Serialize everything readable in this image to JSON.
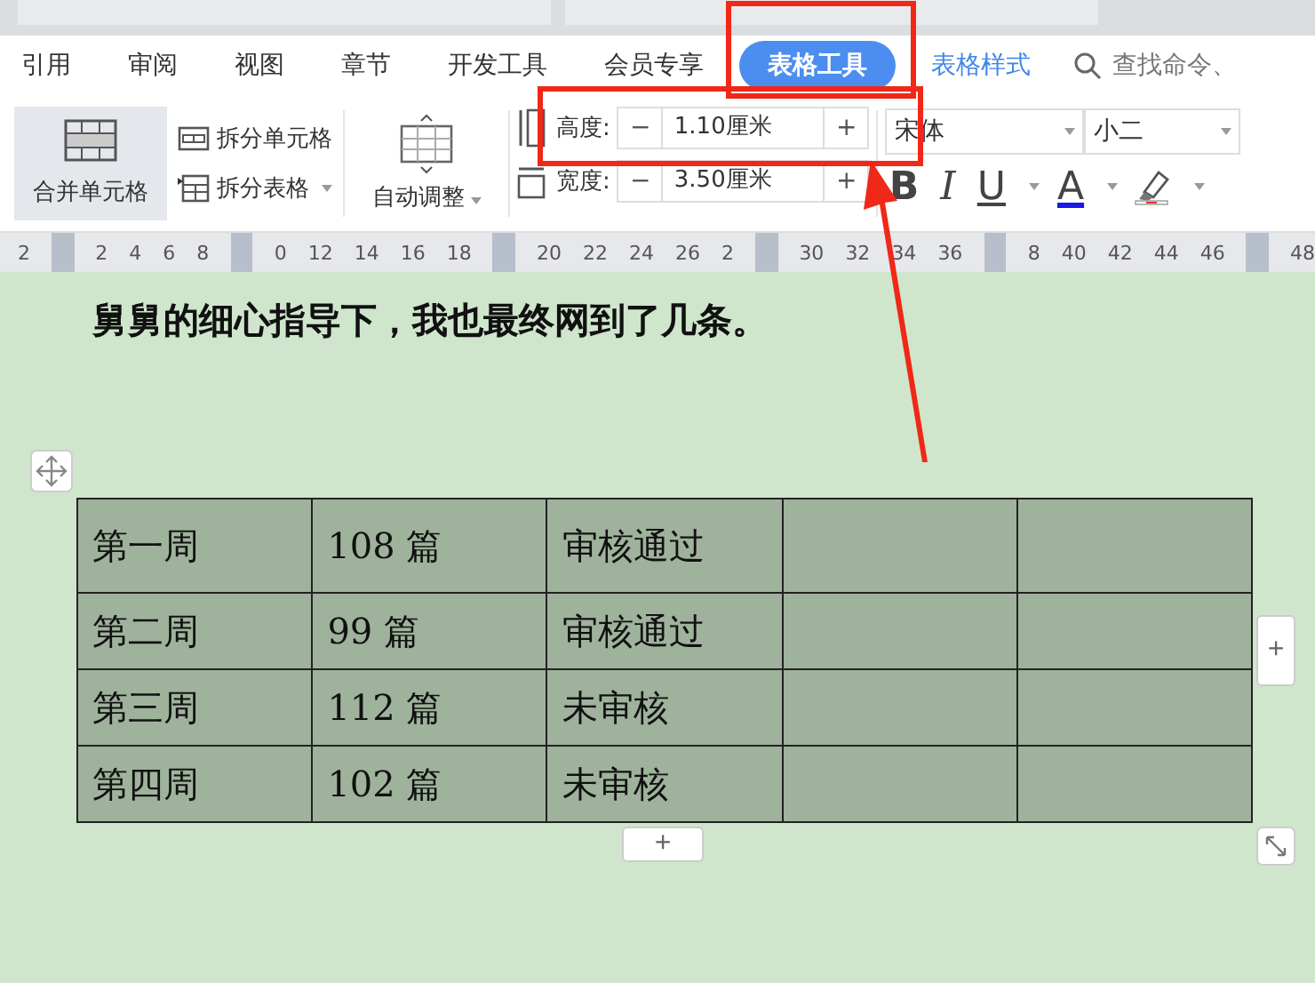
{
  "menu": [
    {
      "label": "引用",
      "selected": false
    },
    {
      "label": "审阅",
      "selected": false
    },
    {
      "label": "视图",
      "selected": false
    },
    {
      "label": "章节",
      "selected": false
    },
    {
      "label": "开发工具",
      "selected": false
    },
    {
      "label": "会员专享",
      "selected": false
    },
    {
      "label": "表格工具",
      "selected": true
    },
    {
      "label": "表格样式",
      "selected": false
    }
  ],
  "search": {
    "placeholder": "查找命令、"
  },
  "ribbon": {
    "merge": "合并单元格",
    "split_cells": "拆分单元格",
    "split_table": "拆分表格",
    "auto_fit": "自动调整",
    "height": {
      "label": "高度:",
      "value": "1.10厘米",
      "minus": "−",
      "plus": "+"
    },
    "width": {
      "label": "宽度:",
      "value": "3.50厘米",
      "minus": "−",
      "plus": "+"
    },
    "font": "宋体",
    "size": "小二",
    "bold": "B",
    "italic": "I",
    "underline": "U",
    "font_color_letter": "A"
  },
  "ruler": [
    {
      "kind": "num",
      "label": "2"
    },
    {
      "kind": "marker"
    },
    {
      "kind": "num",
      "label": "2"
    },
    {
      "kind": "num",
      "label": "4"
    },
    {
      "kind": "num",
      "label": "6"
    },
    {
      "kind": "num",
      "label": "8"
    },
    {
      "kind": "marker"
    },
    {
      "kind": "num",
      "label": "0"
    },
    {
      "kind": "num",
      "label": "12"
    },
    {
      "kind": "num",
      "label": "14"
    },
    {
      "kind": "num",
      "label": "16"
    },
    {
      "kind": "num",
      "label": "18"
    },
    {
      "kind": "marker"
    },
    {
      "kind": "num",
      "label": "20"
    },
    {
      "kind": "num",
      "label": "22"
    },
    {
      "kind": "num",
      "label": "24"
    },
    {
      "kind": "num",
      "label": "26"
    },
    {
      "kind": "num",
      "label": "2"
    },
    {
      "kind": "marker"
    },
    {
      "kind": "num",
      "label": "30"
    },
    {
      "kind": "num",
      "label": "32"
    },
    {
      "kind": "num",
      "label": "34"
    },
    {
      "kind": "num",
      "label": "36"
    },
    {
      "kind": "marker"
    },
    {
      "kind": "num",
      "label": "8"
    },
    {
      "kind": "num",
      "label": "40"
    },
    {
      "kind": "num",
      "label": "42"
    },
    {
      "kind": "num",
      "label": "44"
    },
    {
      "kind": "num",
      "label": "46"
    },
    {
      "kind": "marker"
    },
    {
      "kind": "num",
      "label": "48"
    }
  ],
  "document": {
    "text": "舅舅的细心指导下，我也最终网到了几条。",
    "table": {
      "rows": [
        [
          "第一周",
          "108 篇",
          "审核通过",
          "",
          ""
        ],
        [
          "第二周",
          "99 篇",
          "审核通过",
          "",
          ""
        ],
        [
          "第三周",
          "112 篇",
          "未审核",
          "",
          ""
        ],
        [
          "第四周",
          "102 篇",
          "未审核",
          "",
          ""
        ]
      ]
    },
    "add_row": "+",
    "add_column": "+"
  }
}
